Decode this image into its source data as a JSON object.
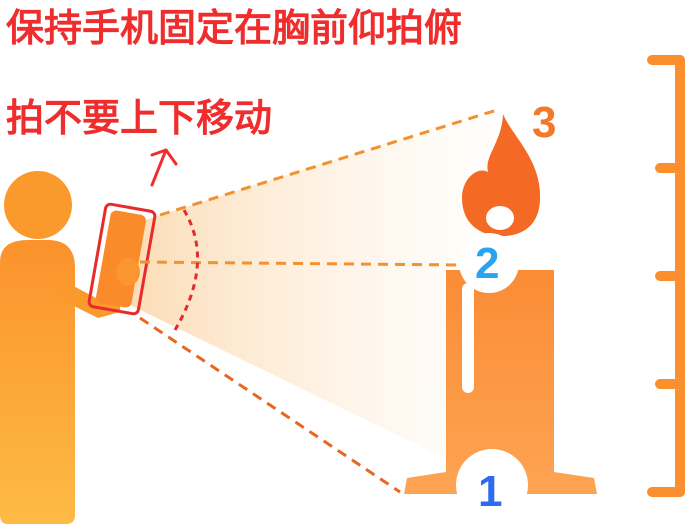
{
  "instructions": {
    "line1": "保持手机固定在胸前仰拍俯",
    "line2": "拍不要上下移动"
  },
  "markers": {
    "point1": "1",
    "point2": "2",
    "point3": "3"
  },
  "colors": {
    "text_red": "#ef2d2d",
    "orange": "#fb8f2e",
    "orange_light": "#fdb53f",
    "flame": "#f46a24",
    "blue": "#2d6cf0",
    "sky_blue": "#2aa4f0",
    "dash_orange": "#f2922f",
    "phone_outline": "#e82a2a"
  },
  "icons": {
    "person": "person-silhouette",
    "phone": "smartphone",
    "candle": "candle",
    "flame": "flame",
    "ruler": "height-ruler",
    "arrow": "up-arrow"
  }
}
